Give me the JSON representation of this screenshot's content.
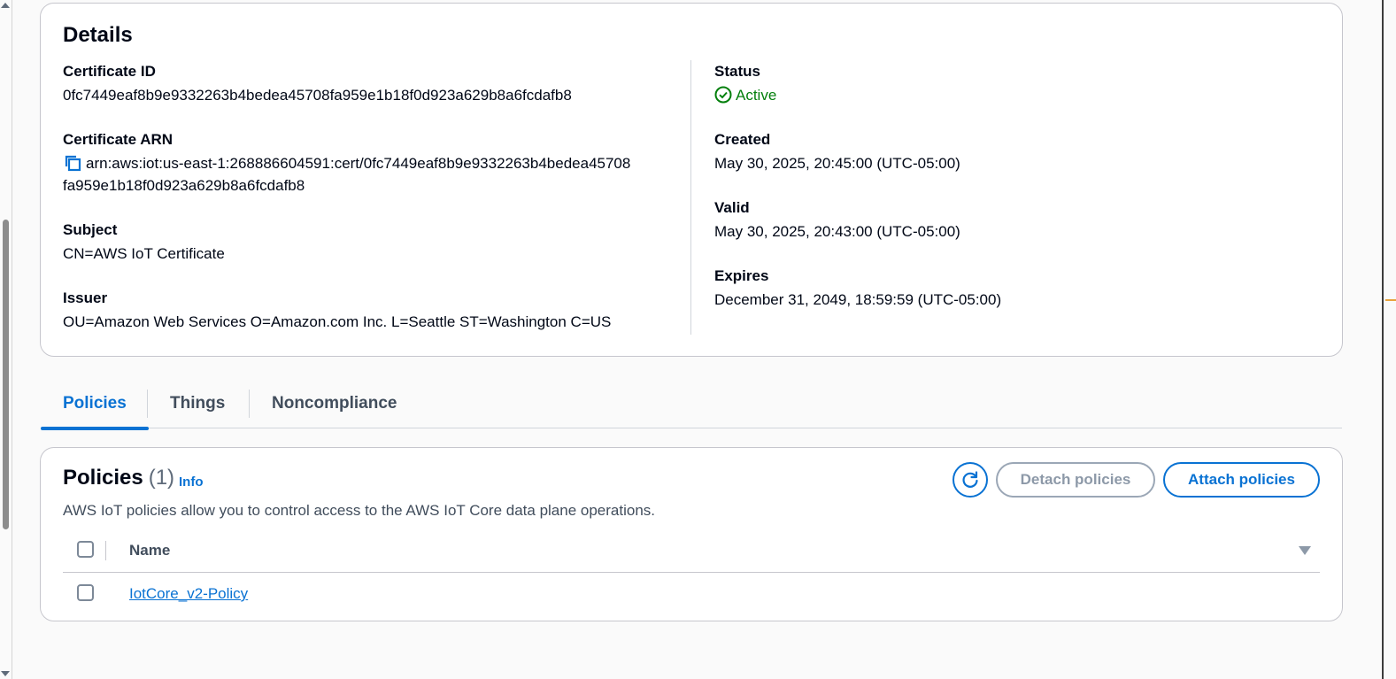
{
  "details": {
    "title": "Details",
    "certificate_id_label": "Certificate ID",
    "certificate_id": "0fc7449eaf8b9e9332263b4bedea45708fa959e1b18f0d923a629b8a6fcdafb8",
    "certificate_arn_label": "Certificate ARN",
    "certificate_arn_line1": "arn:aws:iot:us-east-1:268886604591:cert/0fc7449eaf8b9e9332263b4bedea45708",
    "certificate_arn_line2": "fa959e1b18f0d923a629b8a6fcdafb8",
    "subject_label": "Subject",
    "subject": "CN=AWS IoT Certificate",
    "issuer_label": "Issuer",
    "issuer": "OU=Amazon Web Services O=Amazon.com Inc. L=Seattle ST=Washington C=US",
    "status_label": "Status",
    "status": "Active",
    "created_label": "Created",
    "created": "May 30, 2025, 20:45:00 (UTC-05:00)",
    "valid_label": "Valid",
    "valid": "May 30, 2025, 20:43:00 (UTC-05:00)",
    "expires_label": "Expires",
    "expires": "December 31, 2049, 18:59:59 (UTC-05:00)"
  },
  "tabs": [
    {
      "label": "Policies",
      "active": true
    },
    {
      "label": "Things",
      "active": false
    },
    {
      "label": "Noncompliance",
      "active": false
    }
  ],
  "policies": {
    "title": "Policies",
    "count": "(1)",
    "info": "Info",
    "description": "AWS IoT policies allow you to control access to the AWS IoT Core data plane operations.",
    "detach_label": "Detach policies",
    "attach_label": "Attach policies",
    "column_name": "Name",
    "rows": [
      {
        "name": "IotCore_v2-Policy"
      }
    ]
  },
  "colors": {
    "accent": "#0972d3",
    "success": "#037f0c",
    "disabled": "#8d99a8"
  },
  "icons": [
    "copy-icon",
    "status-check-icon",
    "refresh-icon",
    "sort-caret-icon"
  ]
}
